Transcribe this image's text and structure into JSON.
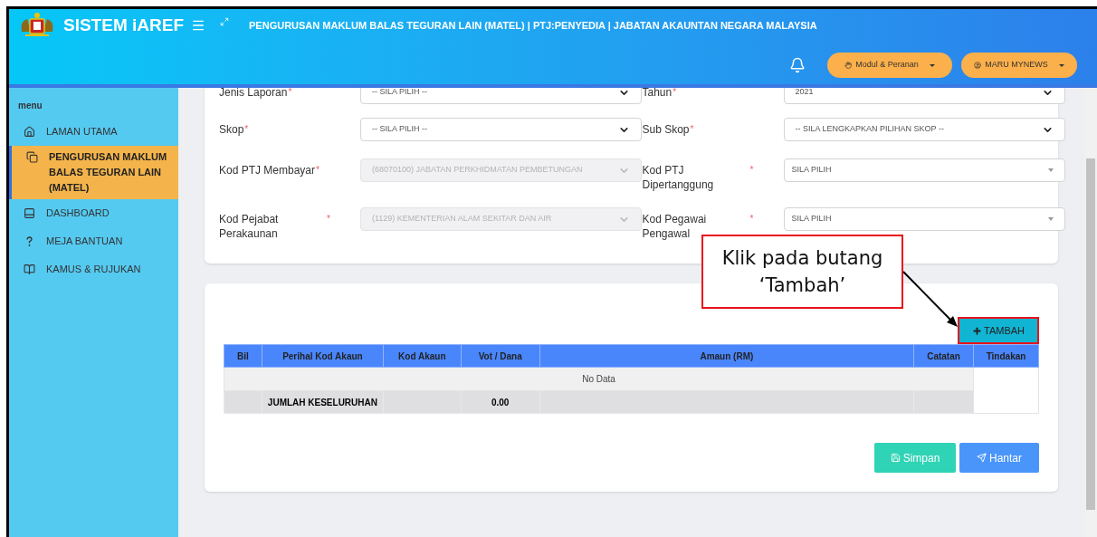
{
  "header": {
    "system_name": "SISTEM iAREF",
    "title": "PENGURUSAN MAKLUM BALAS TEGURAN LAIN (MATEL) | PTJ:PENYEDIA | JABATAN AKAUNTAN NEGARA MALAYSIA",
    "module_button": "Modul & Peranan",
    "user_button": "MARU MYNEWS"
  },
  "sidebar": {
    "heading": "menu",
    "items": [
      {
        "label": "LAMAN UTAMA",
        "selected": false
      },
      {
        "label": "PENGURUSAN MAKLUM BALAS TEGURAN LAIN (MATEL)",
        "selected": true
      },
      {
        "label": "DASHBOARD",
        "selected": false
      },
      {
        "label": "MEJA BANTUAN",
        "selected": false
      },
      {
        "label": "KAMUS & RUJUKAN",
        "selected": false
      }
    ]
  },
  "form": {
    "fields": [
      {
        "label": "Jenis Laporan",
        "required_mark": "*",
        "value": "-- SILA PILIH --",
        "kind": "native",
        "disabled": false
      },
      {
        "label": "Tahun",
        "required_mark": "*",
        "value": "2021",
        "kind": "native",
        "disabled": false
      },
      {
        "label": "Skop",
        "required_mark": "*",
        "value": "-- SILA PILIH --",
        "kind": "native",
        "disabled": false
      },
      {
        "label": "Sub Skop",
        "required_mark": "*",
        "value": "-- SILA LENGKAPKAN PILIHAN SKOP --",
        "kind": "native",
        "disabled": false
      },
      {
        "label": "Kod PTJ Membayar",
        "required_mark": "*",
        "value": "(68070100) JABATAN PERKHIDMATAN PEMBETUNGAN",
        "kind": "native",
        "disabled": true
      },
      {
        "label": "Kod PTJ Dipertanggung",
        "required_mark": "*",
        "value": "SILA PILIH",
        "kind": "search",
        "disabled": false
      },
      {
        "label": "Kod Pejabat Perakaunan",
        "required_mark": "*",
        "value": "(1129) KEMENTERIAN ALAM SEKITAR DAN AIR",
        "kind": "native",
        "disabled": true
      },
      {
        "label": "Kod Pegawai Pengawal",
        "required_mark": "*",
        "value": "SILA PILIH",
        "kind": "search",
        "disabled": false
      }
    ]
  },
  "table": {
    "add_button": "TAMBAH",
    "columns": [
      "Bil",
      "Perihal Kod Akaun",
      "Kod Akaun",
      "Vot / Dana",
      "Amaun (RM)",
      "Catatan",
      "Tindakan"
    ],
    "empty_text": "No Data",
    "total_label": "JUMLAH KESELURUHAN",
    "total_value": "0.00"
  },
  "actions": {
    "save": "Simpan",
    "send": "Hantar"
  },
  "callout": {
    "lines": [
      "Klik pada butang",
      "‘Tambah’"
    ]
  }
}
